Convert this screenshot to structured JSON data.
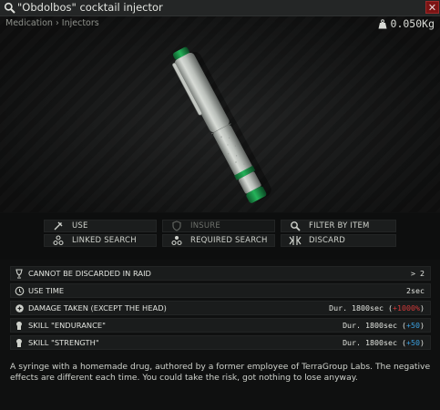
{
  "window": {
    "title": "\"Obdolbos\" cocktail injector",
    "close_label": "✕"
  },
  "preview": {
    "breadcrumb": "Medication › Injectors",
    "weight": "0.050Kg"
  },
  "actions": [
    {
      "label": "USE",
      "icon": "syringe-icon",
      "enabled": true
    },
    {
      "label": "INSURE",
      "icon": "shield-icon",
      "enabled": false
    },
    {
      "label": "FILTER BY ITEM",
      "icon": "magnifier-icon",
      "enabled": true
    },
    {
      "label": "LINKED SEARCH",
      "icon": "linked-search-icon",
      "enabled": true
    },
    {
      "label": "REQUIRED SEARCH",
      "icon": "required-search-icon",
      "enabled": true
    },
    {
      "label": "DISCARD",
      "icon": "discard-icon",
      "enabled": true
    }
  ],
  "properties": [
    {
      "label": "CANNOT BE DISCARDED IN RAID",
      "icon": "goblet-icon",
      "value": "> 2"
    },
    {
      "label": "USE TIME",
      "icon": "clock-icon",
      "value": "2sec"
    },
    {
      "label": "DAMAGE TAKEN (EXCEPT THE HEAD)",
      "icon": "damage-icon",
      "value_prefix": "Dur. 1800sec (",
      "value_highlight": "+1000%",
      "value_suffix": ")",
      "highlight_color": "#d23a3a"
    },
    {
      "label": "SKILL \"ENDURANCE\"",
      "icon": "skill-icon",
      "value_prefix": "Dur. 1800sec (",
      "value_highlight": "+50",
      "value_suffix": ")",
      "highlight_color": "#3aa0e0"
    },
    {
      "label": "SKILL \"STRENGTH\"",
      "icon": "skill-icon",
      "value_prefix": "Dur. 1800sec (",
      "value_highlight": "+50",
      "value_suffix": ")",
      "highlight_color": "#3aa0e0"
    }
  ],
  "description": "A syringe with a homemade drug, authored by a former employee of TerraGroup Labs. The negative effects are different each time. You could take the risk, got nothing to lose anyway."
}
